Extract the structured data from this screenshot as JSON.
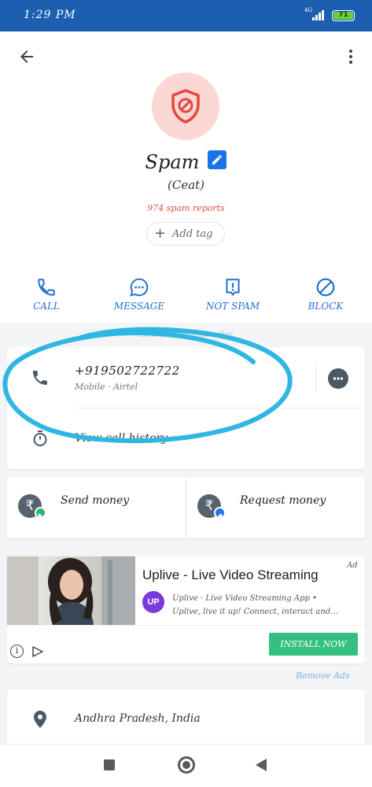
{
  "status_bar": {
    "time": "1:29 PM",
    "network": "4G",
    "battery": "71",
    "bar_color": "#1c5fb0"
  },
  "header": {
    "back_icon": "arrow-back-icon",
    "more_icon": "more-vert-icon",
    "avatar_icon": "spam-shield-icon",
    "name": "Spam",
    "subname": "(Ceat)",
    "spam_reports": "974 spam reports",
    "add_tag": "Add tag"
  },
  "actions": [
    {
      "label": "CALL",
      "icon": "phone-icon"
    },
    {
      "label": "MESSAGE",
      "icon": "chat-bubble-icon"
    },
    {
      "label": "NOT SPAM",
      "icon": "report-icon"
    },
    {
      "label": "BLOCK",
      "icon": "block-icon"
    }
  ],
  "identified_text": "Identified by Truecaller",
  "phone": {
    "number": "+919502722722",
    "carrier": "Mobile · Airtel",
    "view_history": "View call history"
  },
  "money": {
    "send": "Send money",
    "request": "Request money"
  },
  "ad": {
    "tag": "Ad",
    "title": "Uplive - Live Video Streaming",
    "logo_text": "UP",
    "description_line1": "Uplive · Live Video Streaming App •",
    "description_line2": "Uplive, live it up! Connect, interact and...",
    "install": "INSTALL NOW",
    "remove_ads": "Remove Ads"
  },
  "location": {
    "text": "Andhra Pradesh, India"
  },
  "colors": {
    "accent": "#1f6fd0",
    "spam_red": "#e54b44",
    "install_green": "#33c080",
    "scribble": "#2fb6e3"
  }
}
